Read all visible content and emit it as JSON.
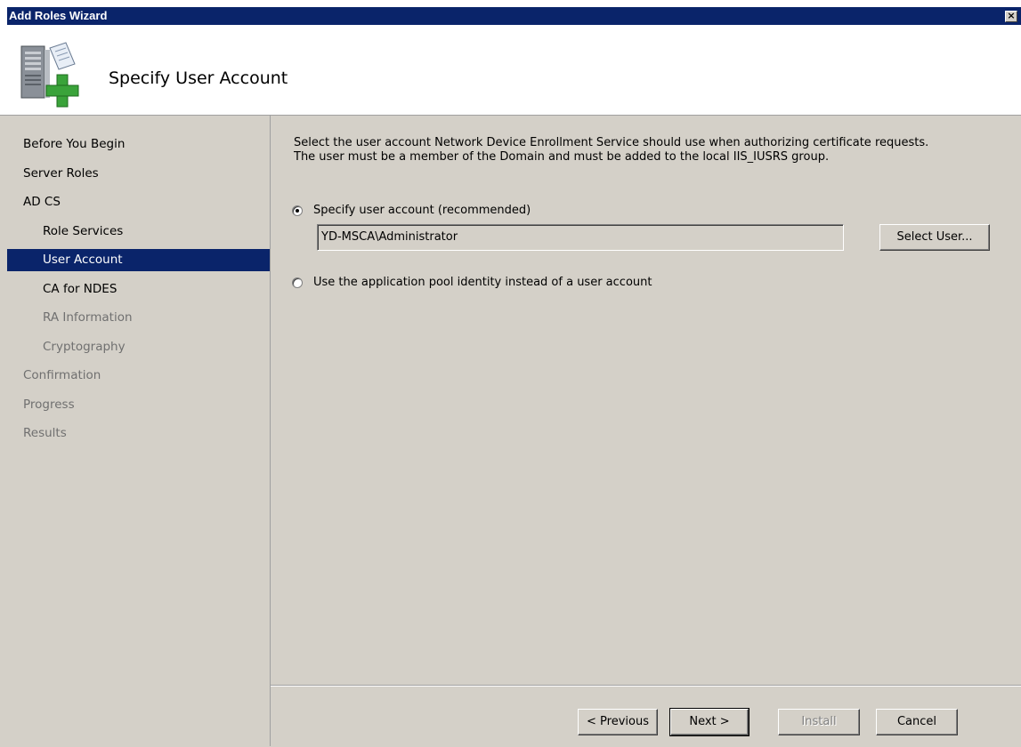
{
  "window": {
    "title": "Add Roles Wizard",
    "close_glyph": "×"
  },
  "header": {
    "title": "Specify User Account",
    "icon": "server-add-icon"
  },
  "nav": {
    "items": [
      {
        "label": "Before You Begin",
        "level": 0,
        "state": "normal"
      },
      {
        "label": "Server Roles",
        "level": 0,
        "state": "normal"
      },
      {
        "label": "AD CS",
        "level": 0,
        "state": "normal"
      },
      {
        "label": "Role Services",
        "level": 1,
        "state": "normal"
      },
      {
        "label": "User Account",
        "level": 1,
        "state": "selected"
      },
      {
        "label": "CA for NDES",
        "level": 1,
        "state": "normal"
      },
      {
        "label": "RA Information",
        "level": 1,
        "state": "dim"
      },
      {
        "label": "Cryptography",
        "level": 1,
        "state": "dim"
      },
      {
        "label": "Confirmation",
        "level": 0,
        "state": "dim"
      },
      {
        "label": "Progress",
        "level": 0,
        "state": "dim"
      },
      {
        "label": "Results",
        "level": 0,
        "state": "dim"
      }
    ]
  },
  "main": {
    "description_line1": "Select the user account Network Device Enrollment Service should use when authorizing certificate requests.",
    "description_line2": "The user must be a member of the Domain and must be added to the local IIS_IUSRS group.",
    "option_specify_label": "Specify user account (recommended)",
    "option_specify_checked": true,
    "user_value": "YD-MSCA\\Administrator",
    "select_user_label": "Select User...",
    "option_pool_label": "Use the application pool identity instead of a user account",
    "option_pool_checked": false
  },
  "footer": {
    "previous_label": "< Previous",
    "next_label": "Next >",
    "install_label": "Install",
    "cancel_label": "Cancel"
  },
  "colors": {
    "selection": "#0a246a",
    "face": "#d4d0c8",
    "dim_text": "#707070"
  }
}
